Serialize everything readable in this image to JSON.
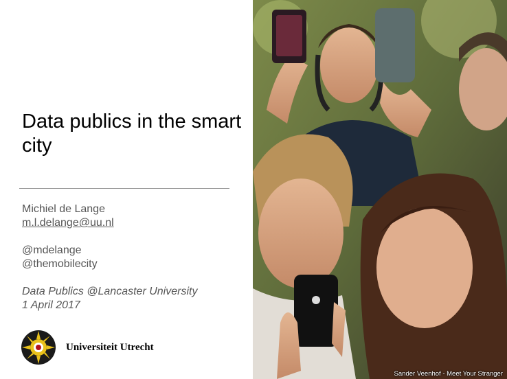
{
  "slide": {
    "title": "Data publics in the smart city",
    "author": "Michiel de Lange",
    "email": "m.l.delange@uu.nl",
    "handles": [
      "@mdelange",
      "@themobilecity"
    ],
    "event": "Data Publics @Lancaster University",
    "date": "1 April 2017",
    "university": "Universiteit Utrecht",
    "photo_caption": "Sander Veenhof - Meet Your Stranger"
  }
}
